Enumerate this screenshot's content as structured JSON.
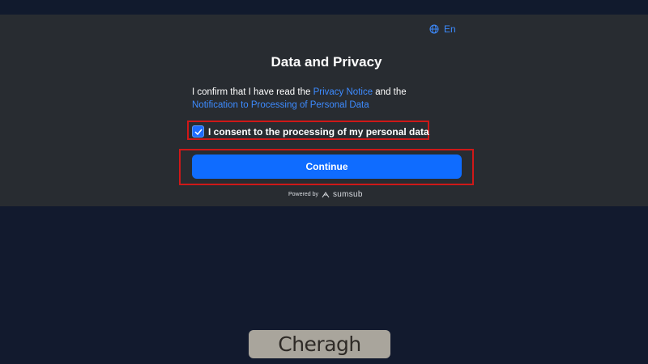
{
  "language": {
    "label": "En",
    "icon": "globe-icon"
  },
  "title": "Data and Privacy",
  "confirm": {
    "prefix": "I confirm that I have read the ",
    "privacy_link": "Privacy Notice",
    "middle": " and the",
    "notification_link": "Notification to Processing of Personal Data"
  },
  "consent": {
    "checked": true,
    "label": "I consent to the processing of my personal data"
  },
  "continue_label": "Continue",
  "powered_by": {
    "prefix": "Powered by",
    "brand": "sumsub"
  },
  "watermark": "Cheragh",
  "colors": {
    "accent": "#0f6cff",
    "link": "#3d8bff",
    "highlight": "#cf1818"
  }
}
